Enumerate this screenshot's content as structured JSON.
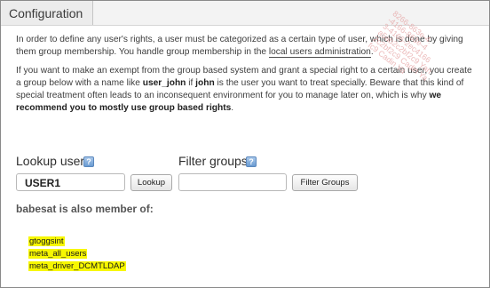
{
  "header": {
    "title": "Configuration"
  },
  "intro": {
    "p1_before": "In order to define any user's rights, a user must be categorized as a certain type of user, which is done by giving them group membership. You handle group membership in the ",
    "p1_link": "local users administration",
    "p1_after": ".",
    "p2_part1": "If you want to make an exempt from the group based system and grant a special right to a certain user, you create a group below with a name like ",
    "p2_bold1": "user_john",
    "p2_part2": " if ",
    "p2_bold2": "john",
    "p2_part3": " is the user you want to treat specially. Beware that this kind of special treatment often leads to an inconsequent environment for you to manage later on, which is why ",
    "p2_bold3": "we recommend you to mostly use group based rights",
    "p2_part4": "."
  },
  "lookup": {
    "label": "Lookup user",
    "help_glyph": "?",
    "value": "USER1",
    "button_label": "Lookup"
  },
  "filter": {
    "label": "Filter groups",
    "help_glyph": "?",
    "value": "",
    "button_label": "Filter Groups"
  },
  "membership": {
    "heading": "babesat is also member of:",
    "groups": [
      "gtoggsint",
      "meta_all_users",
      "meta_driver_DCMTLDAP"
    ]
  },
  "watermark": {
    "lines": [
      "8266-863e-4.",
      "-4166-863e-4",
      "3-4166-2ec4166",
      "a5ab2c2bf2c9 Yan",
      "2c2bf2c9 Cadin Ya",
      "fc9 Cadin Ya"
    ]
  }
}
